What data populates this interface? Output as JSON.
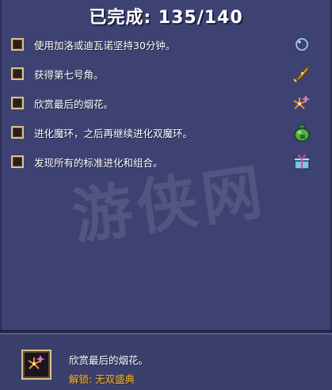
{
  "header": {
    "title": "已完成: 135/140"
  },
  "achievements": [
    {
      "label": "使用加洛或迪瓦诺坚持30分钟。",
      "icon": "ring-icon",
      "checked": false
    },
    {
      "label": "获得第七号角。",
      "icon": "golden-horn-icon",
      "checked": false
    },
    {
      "label": "欣赏最后的烟花。",
      "icon": "fireworks-icon",
      "checked": false
    },
    {
      "label": "进化魔环，之后再继续进化双魔环。",
      "icon": "green-money-bag-icon",
      "checked": false
    },
    {
      "label": "发现所有的标准进化和组合。",
      "icon": "gift-box-icon",
      "checked": false
    }
  ],
  "detail": {
    "icon": "fireworks-icon",
    "description": "欣赏最后的烟花。",
    "unlock_text": "解锁: 无双盛典"
  },
  "watermark": "游侠网",
  "colors": {
    "accent": "#f2b632",
    "panel": "#3e4272",
    "checkbox_border": "#d9c08a"
  }
}
